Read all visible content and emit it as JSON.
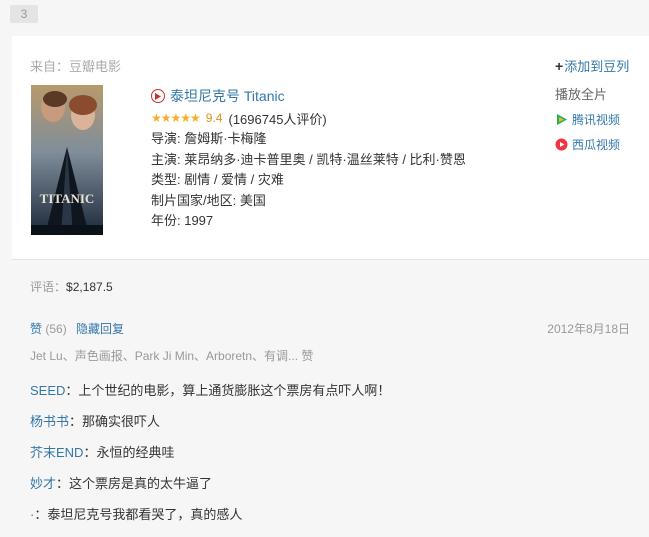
{
  "page_number": "3",
  "card": {
    "source": "来自：豆瓣电影",
    "add_to_douban": "添加到豆列",
    "watch_full_label": "播放全片",
    "providers": [
      {
        "name": "腾讯视频",
        "icon": "tencent-video-icon",
        "color": "#20b15e"
      },
      {
        "name": "西瓜视频",
        "icon": "xigua-video-icon",
        "color": "#ee3642"
      }
    ],
    "poster_title": "TITANIC",
    "movie_title": "泰坦尼克号 Titanic",
    "stars": "★★★★★",
    "score": "9.4",
    "votes": "(1696745人评价)",
    "director": "导演: 詹姆斯·卡梅隆",
    "cast": "主演: 莱昂纳多·迪卡普里奥 / 凯特·温丝莱特 / 比利·赞恩",
    "genre": "类型: 剧情 / 爱情 / 灾难",
    "country": "制片国家/地区: 美国",
    "year": "年份: 1997"
  },
  "review": {
    "price_label": "评语：",
    "price_value": "$2,187.5",
    "likes_label": "赞",
    "likes_count": "(56)",
    "hide_replies": "隐藏回复",
    "date": "2012年8月18日",
    "likers": "Jet Lu、声色画报、Park Ji Min、Arboretn、有调... 赞"
  },
  "comments": [
    {
      "author": "SEED",
      "text": "上个世纪的电影，算上通货膨胀这个票房有点吓人啊！"
    },
    {
      "author": "杨书书",
      "text": "那确实很吓人"
    },
    {
      "author": "芥末END",
      "text": "永恒的经典哇"
    },
    {
      "author": "妙才",
      "text": "这个票房是真的太牛逼了"
    },
    {
      "author": "·",
      "text": "泰坦尼克号我都看哭了，真的感人"
    }
  ],
  "colors": {
    "link": "#3377aa",
    "star": "#f6ae2c",
    "score": "#e09015"
  }
}
